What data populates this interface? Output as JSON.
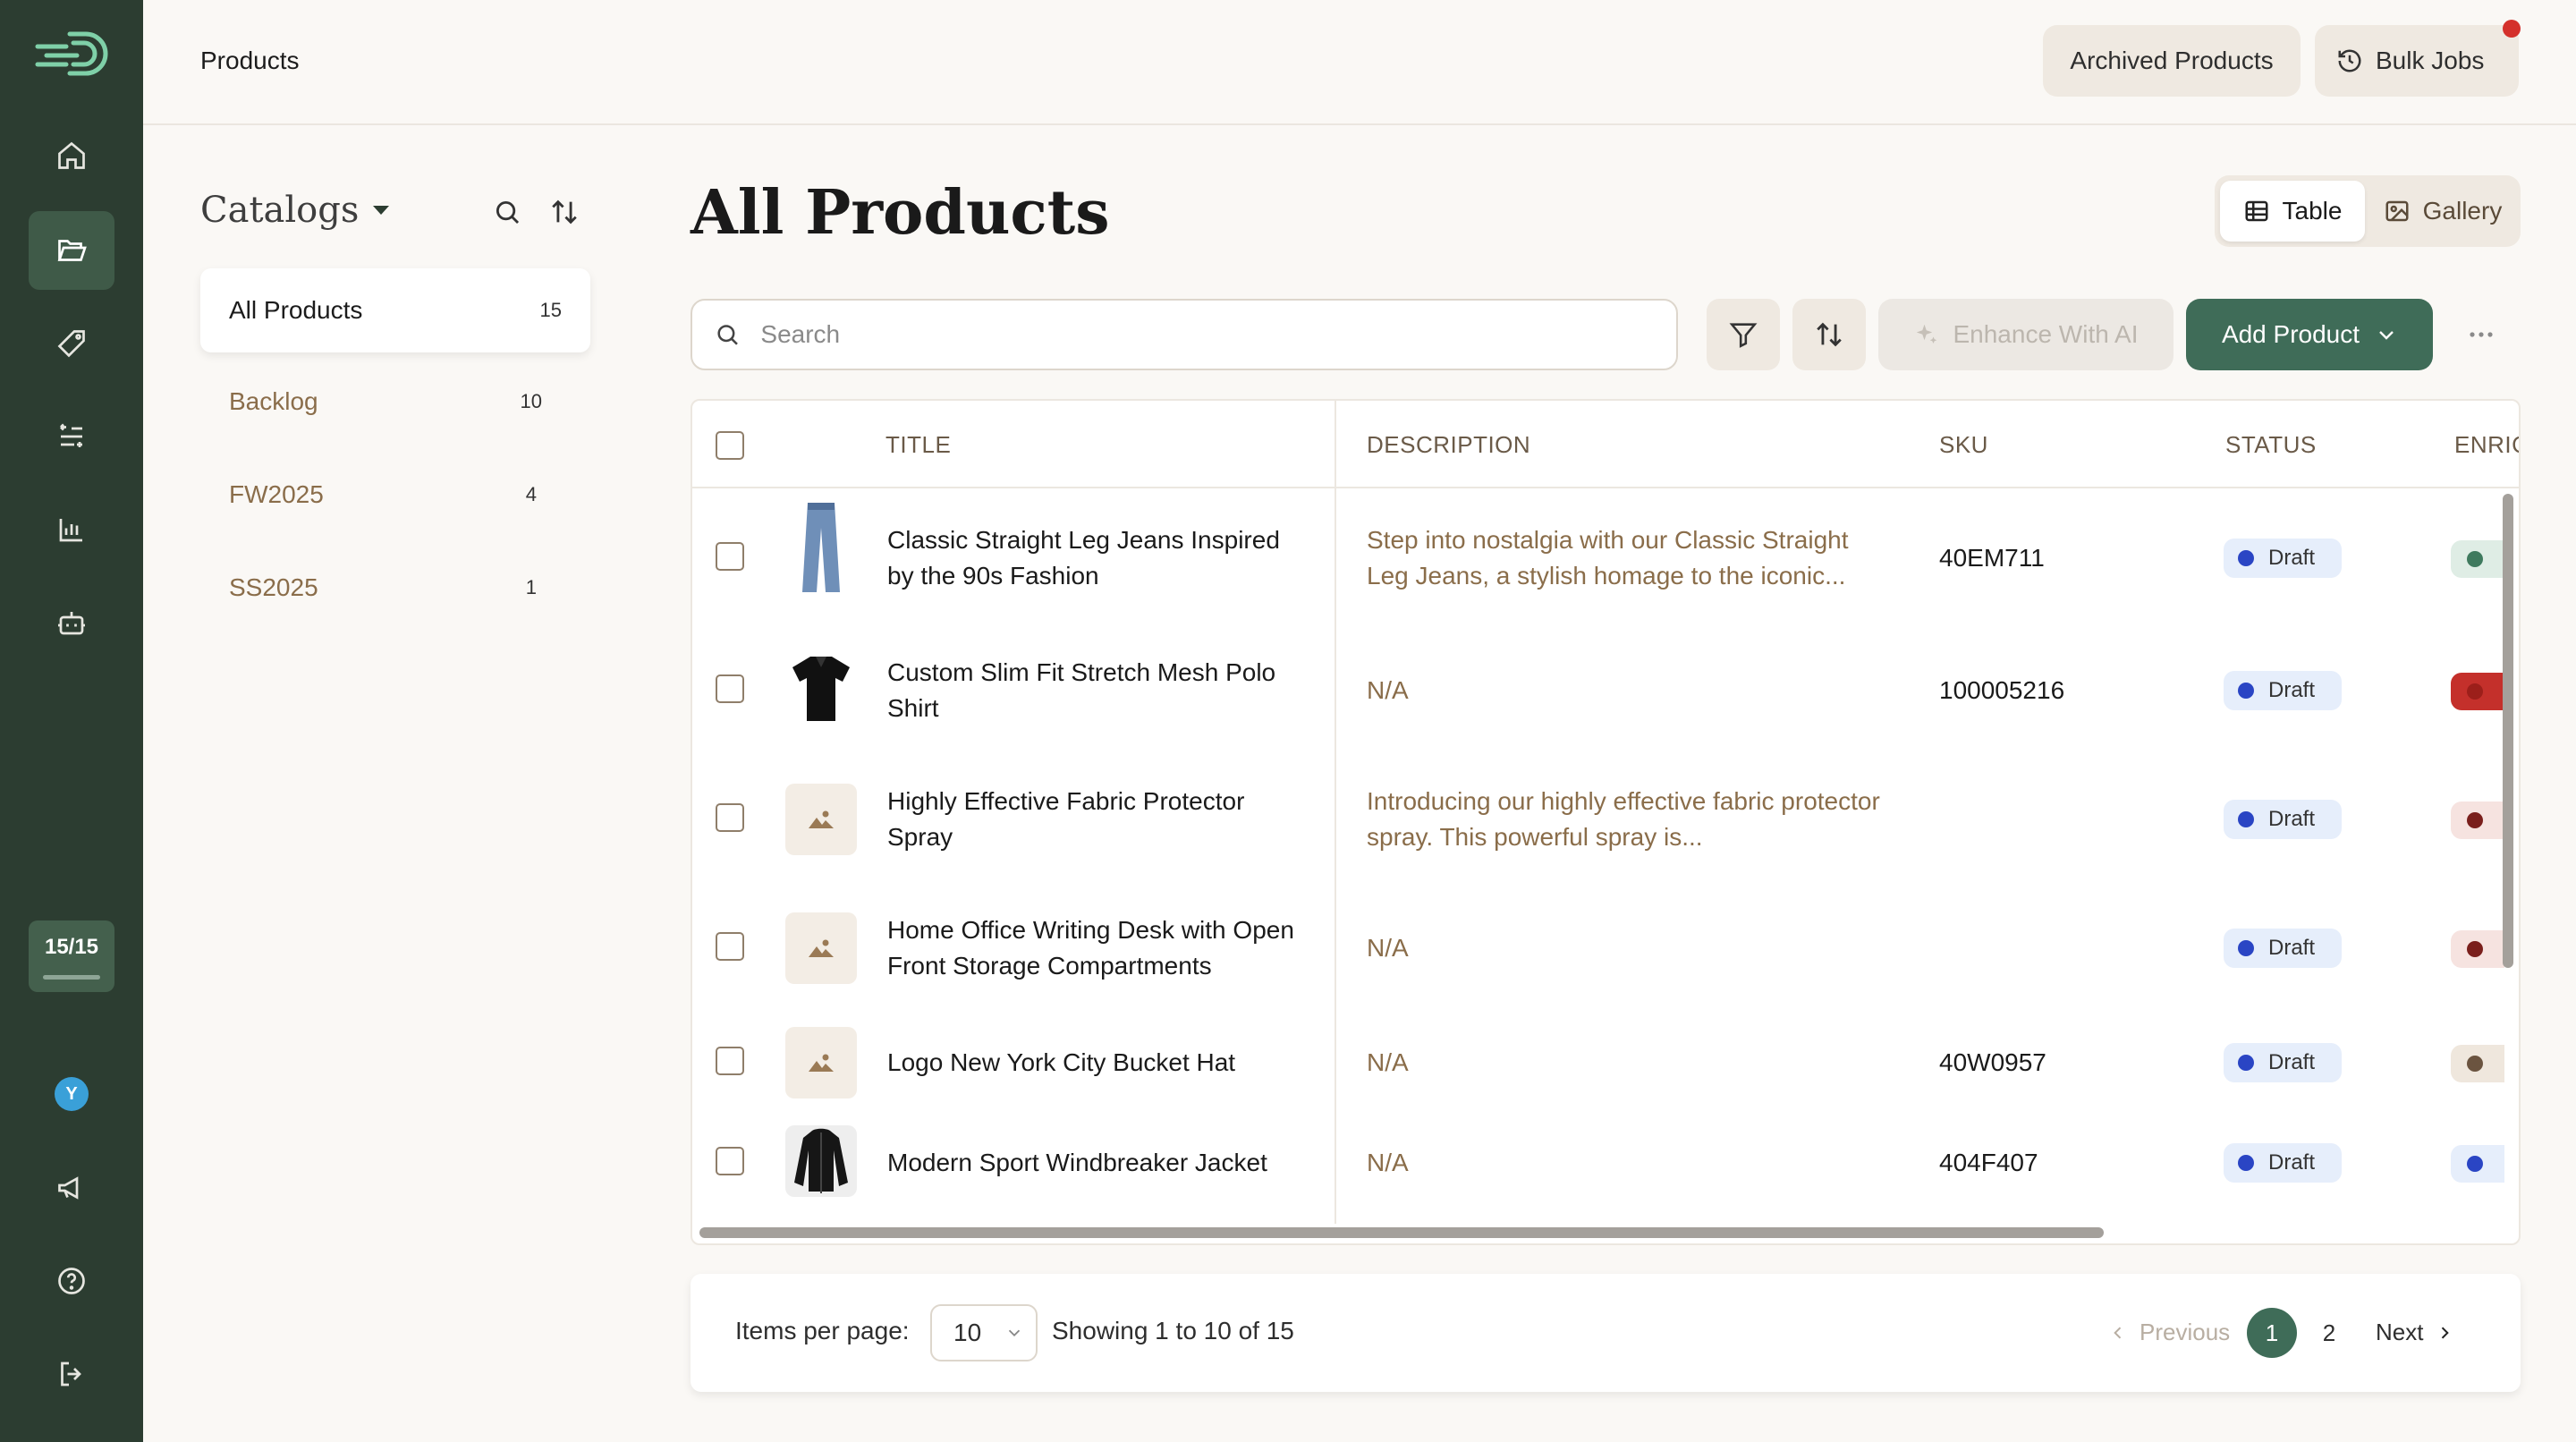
{
  "header": {
    "page_name": "Products",
    "archived_label": "Archived Products",
    "bulk_jobs_label": "Bulk Jobs"
  },
  "rail": {
    "counter": "15/15",
    "avatar_initial": "Y",
    "nav_icons": [
      "home-icon",
      "folder-icon",
      "tag-icon",
      "list-transfer-icon",
      "bar-chart-icon",
      "robot-icon"
    ],
    "bottom_icons": [
      "megaphone-icon",
      "help-icon",
      "logout-icon"
    ]
  },
  "catalogs": {
    "title": "Catalogs",
    "items": [
      {
        "name": "All Products",
        "count": "15"
      },
      {
        "name": "Backlog",
        "count": "10"
      },
      {
        "name": "FW2025",
        "count": "4"
      },
      {
        "name": "SS2025",
        "count": "1"
      }
    ]
  },
  "main": {
    "title": "All Products",
    "view_table": "Table",
    "view_gallery": "Gallery",
    "search_placeholder": "Search",
    "enhance_label": "Enhance With AI",
    "add_label": "Add Product"
  },
  "table": {
    "columns": [
      "TITLE",
      "DESCRIPTION",
      "SKU",
      "STATUS",
      "ENRIC"
    ],
    "rows": [
      {
        "title": "Classic Straight Leg Jeans Inspired by the 90s Fashion",
        "description": "Step into nostalgia with our Classic Straight Leg Jeans, a stylish homage to the iconic...",
        "sku": "40EM711",
        "status": "Draft",
        "thumb": "jeans",
        "enrich_color": "#3f7a5e"
      },
      {
        "title": "Custom Slim Fit Stretch Mesh Polo Shirt",
        "description": "N/A",
        "sku": "100005216",
        "status": "Draft",
        "thumb": "polo",
        "enrich_color": "#b52b25"
      },
      {
        "title": "Highly Effective Fabric Protector Spray",
        "description": "Introducing our highly effective fabric protector spray. This powerful spray is...",
        "sku": "",
        "status": "Draft",
        "thumb": "placeholder",
        "enrich_color": "#7a1f1c"
      },
      {
        "title": "Home Office Writing Desk with Open Front Storage Compartments",
        "description": "N/A",
        "sku": "",
        "status": "Draft",
        "thumb": "placeholder",
        "enrich_color": "#7a1f1c"
      },
      {
        "title": "Logo New York City Bucket Hat",
        "description": "N/A",
        "sku": "40W0957",
        "status": "Draft",
        "thumb": "placeholder",
        "enrich_color": "#6b5440"
      },
      {
        "title": "Modern Sport Windbreaker Jacket",
        "description": "N/A",
        "sku": "404F407",
        "status": "Draft",
        "thumb": "jacket",
        "enrich_color": "#2a45c4"
      }
    ]
  },
  "pagination": {
    "items_per_page_label": "Items per page:",
    "per_page_value": "10",
    "showing": "Showing 1 to 10 of 15",
    "previous": "Previous",
    "pages": [
      "1",
      "2"
    ],
    "next": "Next"
  },
  "colors": {
    "rail": "#2c3d31",
    "accent": "#3f6c58",
    "status_draft_dot": "#2a45c4",
    "notification": "#d4302b"
  }
}
